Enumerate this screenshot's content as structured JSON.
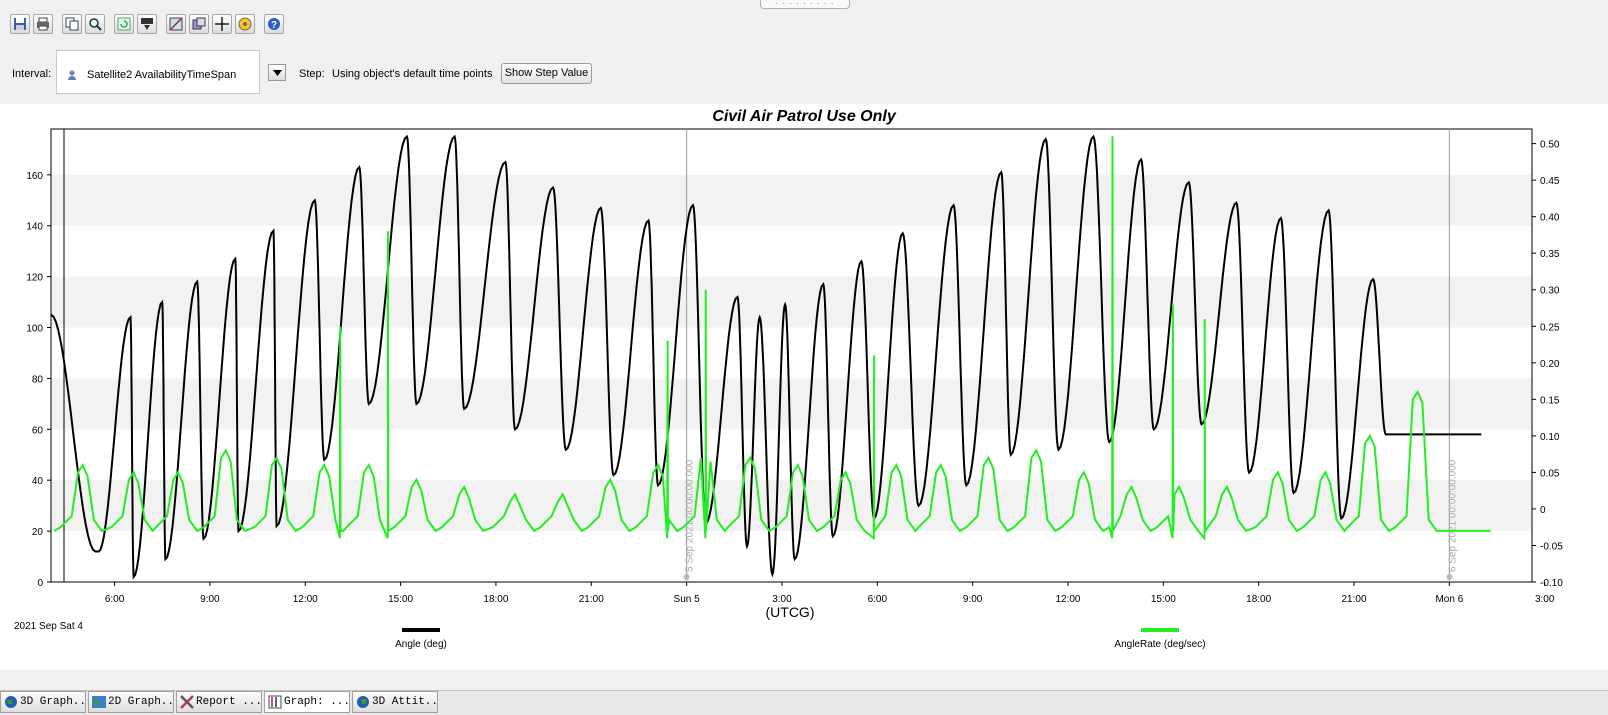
{
  "toolbar": {
    "buttons": [
      "save-icon",
      "print-icon",
      "copy-icon",
      "zoom-icon",
      "refresh-icon",
      "export-icon",
      "properties-icon",
      "options-icon",
      "crosshair-icon",
      "animation-icon",
      "help-icon"
    ]
  },
  "interval": {
    "label": "Interval:",
    "value": "Satellite2 AvailabilityTimeSpan",
    "step_label": "Step:",
    "step_text": "Using object's default time points",
    "show_step_button": "Show Step Value"
  },
  "chart": {
    "title": "Civil Air Patrol Use Only",
    "xlabel": "(UTCG)",
    "start_label": "2021 Sep Sat 4",
    "left_ticks": [
      "0",
      "20",
      "40",
      "60",
      "80",
      "100",
      "120",
      "140",
      "160"
    ],
    "right_ticks": [
      "-0.10",
      "-0.05",
      "0",
      "0.05",
      "0.10",
      "0.15",
      "0.20",
      "0.25",
      "0.30",
      "0.35",
      "0.40",
      "0.45",
      "0.50"
    ],
    "x_ticks": [
      "6:00",
      "9:00",
      "12:00",
      "15:00",
      "18:00",
      "21:00",
      "Sun 5",
      "3:00",
      "6:00",
      "9:00",
      "12:00",
      "15:00",
      "18:00",
      "21:00",
      "Mon 6",
      "3:00"
    ],
    "day_markers": [
      "5 Sep 2021 00:00:00.000",
      "6 Sep 2021 00:00:00.000"
    ],
    "colors": {
      "angle": "#000000",
      "rate": "#22ee22",
      "grid": "#f2f2f2"
    }
  },
  "chart_data": {
    "type": "line",
    "x_unit": "hours since 2021-09-04 04:00 UTCG",
    "ylim": [
      0,
      178
    ],
    "y2lim": [
      -0.1,
      0.52
    ],
    "series": [
      {
        "name": "Angle (deg)",
        "axis": "left",
        "x": [
          0,
          1.4,
          1.5,
          2.5,
          2.6,
          3.5,
          3.6,
          4.6,
          4.8,
          5.8,
          5.9,
          7.0,
          7.1,
          8.3,
          8.6,
          9.7,
          10.0,
          11.2,
          11.5,
          12.7,
          13.0,
          14.3,
          14.6,
          15.8,
          16.2,
          17.3,
          17.7,
          18.8,
          19.1,
          20.2,
          20.6,
          21.6,
          21.9,
          22.3,
          22.7,
          23.1,
          23.4,
          24.3,
          24.6,
          25.5,
          25.9,
          26.8,
          27.3,
          28.4,
          28.8,
          29.9,
          30.2,
          31.3,
          31.7,
          32.8,
          33.3,
          34.3,
          34.7,
          35.8,
          36.2,
          37.3,
          37.7,
          38.7,
          39.1,
          40.2,
          40.6,
          41.6,
          42.0,
          42.5,
          42.8,
          43.4,
          43.9,
          44.3,
          44.7,
          45.0,
          45.3
        ],
        "y": [
          105,
          12,
          12,
          104,
          2,
          110,
          9,
          118,
          17,
          127,
          20,
          138,
          22,
          150,
          48,
          163,
          70,
          175,
          70,
          175,
          68,
          165,
          60,
          155,
          52,
          147,
          42,
          142,
          38,
          148,
          23,
          112,
          14,
          104,
          3,
          109,
          9,
          117,
          18,
          126,
          25,
          137,
          30,
          148,
          38,
          161,
          50,
          174,
          52,
          175,
          55,
          166,
          60,
          157,
          62,
          149,
          43,
          143,
          35,
          146,
          25,
          119,
          58,
          58,
          58,
          58,
          58,
          58,
          58,
          58,
          58
        ]
      },
      {
        "name": "AngleRate (deg/sec)",
        "axis": "right",
        "baseline": -0.03,
        "peaks_x": [
          1.0,
          2.6,
          4.0,
          5.5,
          7.1,
          8.6,
          10.0,
          11.5,
          13.0,
          14.6,
          16.1,
          17.6,
          19.1,
          20.6,
          22.0,
          23.5,
          25.0,
          26.6,
          28.0,
          29.5,
          31.0,
          32.5,
          34.0,
          35.5,
          37.0,
          38.6,
          40.1,
          41.5,
          43.0
        ],
        "peaks_y": [
          0.06,
          0.05,
          0.05,
          0.08,
          0.07,
          0.06,
          0.06,
          0.04,
          0.03,
          0.02,
          0.02,
          0.04,
          0.06,
          0.08,
          0.07,
          0.06,
          0.05,
          0.06,
          0.06,
          0.07,
          0.08,
          0.05,
          0.03,
          0.03,
          0.03,
          0.05,
          0.05,
          0.1,
          0.16
        ],
        "spikes_x": [
          9.1,
          10.6,
          19.4,
          20.6,
          25.9,
          33.4,
          35.3,
          36.3
        ],
        "spikes_y": [
          0.25,
          0.38,
          0.23,
          0.3,
          0.21,
          0.51,
          0.28,
          0.26
        ]
      }
    ]
  },
  "legend": {
    "angle": "Angle (deg)",
    "rate": "AngleRate (deg/sec)"
  },
  "taskbar": [
    "3D Graph...",
    "2D Graph...",
    "Report ...",
    "Graph: ...",
    "3D Attit..."
  ]
}
